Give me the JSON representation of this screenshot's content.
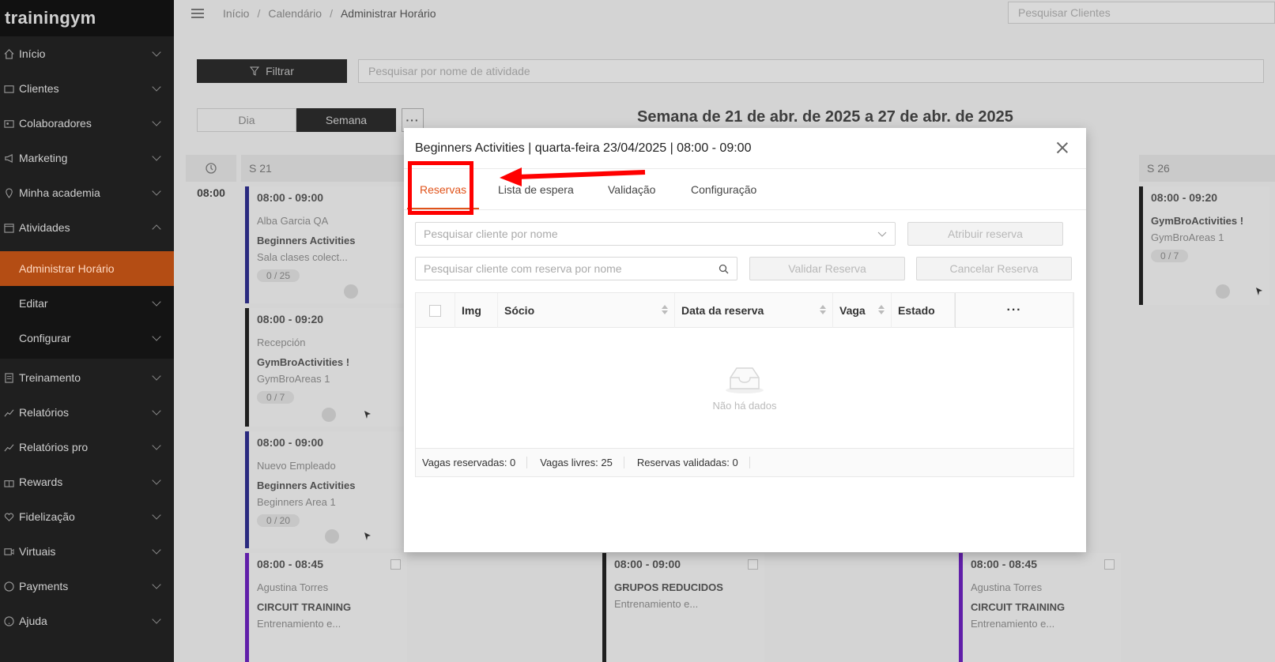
{
  "brand": "trainingym",
  "sidebar": {
    "items": [
      {
        "label": "Início",
        "icon": "home-icon"
      },
      {
        "label": "Clientes",
        "icon": "id-card-icon"
      },
      {
        "label": "Colaboradores",
        "icon": "badge-icon"
      },
      {
        "label": "Marketing",
        "icon": "megaphone-icon"
      },
      {
        "label": "Minha academia",
        "icon": "location-pin-icon"
      },
      {
        "label": "Atividades",
        "icon": "calendar-icon"
      },
      {
        "label": "Treinamento",
        "icon": "clipboard-icon"
      },
      {
        "label": "Relatórios",
        "icon": "chart-line-icon"
      },
      {
        "label": "Relatórios pro",
        "icon": "chart-line-icon"
      },
      {
        "label": "Rewards",
        "icon": "gift-icon"
      },
      {
        "label": "Fidelização",
        "icon": "heart-icon"
      },
      {
        "label": "Virtuais",
        "icon": "video-icon"
      },
      {
        "label": "Payments",
        "icon": "dollar-icon"
      },
      {
        "label": "Ajuda",
        "icon": "help-icon"
      }
    ],
    "subitems": [
      {
        "label": "Administrar Horário"
      },
      {
        "label": "Editar"
      },
      {
        "label": "Configurar"
      }
    ]
  },
  "header": {
    "breadcrumb": [
      "Início",
      "Calendário",
      "Administrar Horário"
    ],
    "search_placeholder": "Pesquisar Clientes"
  },
  "toolbar": {
    "filter_label": "Filtrar",
    "activity_search_placeholder": "Pesquisar por nome de atividade",
    "view_day": "Dia",
    "view_week": "Semana",
    "more": "···",
    "week_title": "Semana de 21 de abr. de 2025 a 27 de abr. de 2025"
  },
  "calendar": {
    "day_headers": [
      "S 21",
      "S 26"
    ],
    "time": "08:00",
    "cards": [
      {
        "time": "08:00 - 09:00",
        "who": "Alba Garcia QA",
        "name": "Beginners Activities",
        "room": "Sala clases colect...",
        "count": "0 / 25"
      },
      {
        "time": "08:00 - 09:20",
        "who": "Recepción",
        "name": "GymBroActivities !",
        "room": "GymBroAreas 1",
        "count": "0 / 7"
      },
      {
        "time": "08:00 - 09:00",
        "who": "Nuevo Empleado",
        "name": "Beginners Activities",
        "room": "Beginners Area 1",
        "count": "0 / 20"
      },
      {
        "time": "08:00 - 08:45",
        "who": "Agustina Torres",
        "name": "CIRCUIT TRAINING",
        "room": "Entrenamiento e..."
      },
      {
        "time": "08:00 - 09:00",
        "who": "",
        "name": "GRUPOS REDUCIDOS",
        "room": "Entrenamiento e..."
      },
      {
        "time": "08:00 - 08:45",
        "who": "Agustina Torres",
        "name": "CIRCUIT TRAINING",
        "room": "Entrenamiento e..."
      },
      {
        "time": "08:00 - 09:20",
        "who": "",
        "name": "GymBroActivities !",
        "room": "GymBroAreas 1",
        "count": "0 / 7"
      }
    ]
  },
  "modal": {
    "title": "Beginners Activities | quarta-feira 23/04/2025 | 08:00 - 09:00",
    "tabs": [
      "Reservas",
      "Lista de espera",
      "Validação",
      "Configuração"
    ],
    "search_client_placeholder": "Pesquisar cliente por nome",
    "assign_label": "Atribuir reserva",
    "search_reserved_placeholder": "Pesquisar cliente com reserva por nome",
    "validate_label": "Validar Reserva",
    "cancel_label": "Cancelar Reserva",
    "columns": [
      "Img",
      "Sócio",
      "Data da reserva",
      "Vaga",
      "Estado"
    ],
    "more": "···",
    "empty_text": "Não há dados",
    "footer": {
      "reserved": "Vagas reservadas: 0",
      "free": "Vagas livres: 25",
      "validated": "Reservas validadas: 0"
    }
  },
  "colors": {
    "accent": "#e0531a",
    "annotation": "#ff0000",
    "sidebar_bg": "#1f1f1f"
  }
}
